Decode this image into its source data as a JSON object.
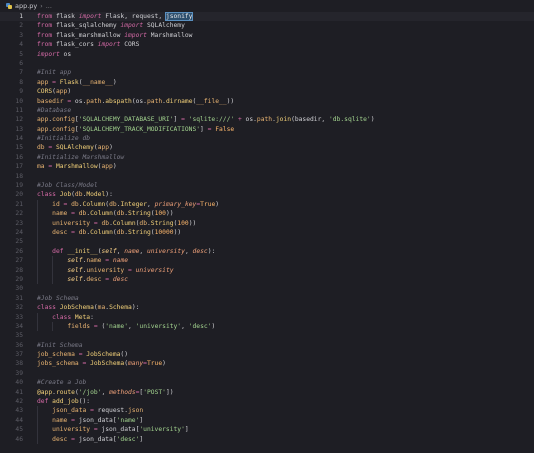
{
  "breadcrumb": {
    "file": "app.py",
    "chevron": "›",
    "ellipsis": "...",
    "icon": "python-file-icon"
  },
  "editor": {
    "active_line": 1,
    "lines": [
      {
        "n": "1",
        "indent": 0,
        "t": [
          [
            "kw2",
            "from"
          ],
          [
            "pl",
            " flask "
          ],
          [
            "kw",
            "import"
          ],
          [
            "pl",
            " Flask, request, "
          ],
          [
            "sel",
            "jsonify"
          ]
        ]
      },
      {
        "n": "2",
        "indent": 0,
        "t": [
          [
            "kw2",
            "from"
          ],
          [
            "pl",
            " flask_sqlalchemy "
          ],
          [
            "kw",
            "import"
          ],
          [
            "pl",
            " SQLAlchemy"
          ]
        ]
      },
      {
        "n": "3",
        "indent": 0,
        "t": [
          [
            "kw2",
            "from"
          ],
          [
            "pl",
            " flask_marshmallow "
          ],
          [
            "kw",
            "import"
          ],
          [
            "pl",
            " Marshmallow"
          ]
        ]
      },
      {
        "n": "4",
        "indent": 0,
        "t": [
          [
            "kw2",
            "from"
          ],
          [
            "pl",
            " flask_cors "
          ],
          [
            "kw",
            "import"
          ],
          [
            "pl",
            " CORS"
          ]
        ]
      },
      {
        "n": "5",
        "indent": 0,
        "t": [
          [
            "kw",
            "import"
          ],
          [
            "pl",
            " os"
          ]
        ]
      },
      {
        "n": "6",
        "indent": 0,
        "t": []
      },
      {
        "n": "7",
        "indent": 0,
        "t": [
          [
            "cm",
            "#Init app"
          ]
        ]
      },
      {
        "n": "8",
        "indent": 0,
        "t": [
          [
            "var",
            "app"
          ],
          [
            "op",
            " = "
          ],
          [
            "fn",
            "Flask"
          ],
          [
            "pl",
            "("
          ],
          [
            "bi",
            "__name__"
          ],
          [
            "pl",
            ")"
          ]
        ]
      },
      {
        "n": "9",
        "indent": 0,
        "t": [
          [
            "fn",
            "CORS"
          ],
          [
            "pl",
            "("
          ],
          [
            "var",
            "app"
          ],
          [
            "pl",
            ")"
          ]
        ]
      },
      {
        "n": "10",
        "indent": 0,
        "t": [
          [
            "var",
            "basedir"
          ],
          [
            "op",
            " = "
          ],
          [
            "pl",
            "os."
          ],
          [
            "var",
            "path"
          ],
          [
            "pl",
            "."
          ],
          [
            "fn",
            "abspath"
          ],
          [
            "pl",
            "(os."
          ],
          [
            "var",
            "path"
          ],
          [
            "pl",
            "."
          ],
          [
            "fn",
            "dirname"
          ],
          [
            "pl",
            "("
          ],
          [
            "bi",
            "__file__"
          ],
          [
            "pl",
            "))"
          ]
        ]
      },
      {
        "n": "11",
        "indent": 0,
        "t": [
          [
            "cm",
            "#Database"
          ]
        ]
      },
      {
        "n": "12",
        "indent": 0,
        "t": [
          [
            "var",
            "app"
          ],
          [
            "pl",
            "."
          ],
          [
            "var",
            "config"
          ],
          [
            "pl",
            "["
          ],
          [
            "str",
            "'SQLALCHEMY_DATABASE_URI'"
          ],
          [
            "pl",
            "]"
          ],
          [
            "op",
            " = "
          ],
          [
            "str",
            "'sqlite:///'"
          ],
          [
            "op",
            " + "
          ],
          [
            "pl",
            "os."
          ],
          [
            "var",
            "path"
          ],
          [
            "pl",
            "."
          ],
          [
            "fn",
            "join"
          ],
          [
            "pl",
            "(basedir, "
          ],
          [
            "str",
            "'db.sqlite'"
          ],
          [
            "pl",
            ")"
          ]
        ]
      },
      {
        "n": "13",
        "indent": 0,
        "t": [
          [
            "var",
            "app"
          ],
          [
            "pl",
            "."
          ],
          [
            "var",
            "config"
          ],
          [
            "pl",
            "["
          ],
          [
            "str",
            "'SQLALCHEMY_TRACK_MODIFICATIONS'"
          ],
          [
            "pl",
            "]"
          ],
          [
            "op",
            " = "
          ],
          [
            "num",
            "False"
          ]
        ]
      },
      {
        "n": "14",
        "indent": 0,
        "t": [
          [
            "cm",
            "#Initialize db"
          ]
        ]
      },
      {
        "n": "15",
        "indent": 0,
        "t": [
          [
            "var",
            "db"
          ],
          [
            "op",
            " = "
          ],
          [
            "fn",
            "SQLAlchemy"
          ],
          [
            "pl",
            "("
          ],
          [
            "var",
            "app"
          ],
          [
            "pl",
            ")"
          ]
        ]
      },
      {
        "n": "16",
        "indent": 0,
        "t": [
          [
            "cm",
            "#Initialize Marshmallow"
          ]
        ]
      },
      {
        "n": "17",
        "indent": 0,
        "t": [
          [
            "var",
            "ma"
          ],
          [
            "op",
            " = "
          ],
          [
            "fn",
            "Marshmallow"
          ],
          [
            "pl",
            "("
          ],
          [
            "var",
            "app"
          ],
          [
            "pl",
            ")"
          ]
        ]
      },
      {
        "n": "18",
        "indent": 0,
        "t": []
      },
      {
        "n": "19",
        "indent": 0,
        "t": [
          [
            "cm",
            "#Job Class/Model"
          ]
        ]
      },
      {
        "n": "20",
        "indent": 0,
        "t": [
          [
            "kw2",
            "class "
          ],
          [
            "cls",
            "Job"
          ],
          [
            "pl",
            "("
          ],
          [
            "var",
            "db"
          ],
          [
            "pl",
            "."
          ],
          [
            "cls",
            "Model"
          ],
          [
            "pl",
            "):"
          ]
        ]
      },
      {
        "n": "21",
        "indent": 1,
        "t": [
          [
            "pl",
            "    "
          ],
          [
            "var",
            "id"
          ],
          [
            "op",
            " = "
          ],
          [
            "var",
            "db"
          ],
          [
            "pl",
            "."
          ],
          [
            "fn",
            "Column"
          ],
          [
            "pl",
            "("
          ],
          [
            "var",
            "db"
          ],
          [
            "pl",
            "."
          ],
          [
            "cls",
            "Integer"
          ],
          [
            "pl",
            ", "
          ],
          [
            "param",
            "primary_key"
          ],
          [
            "op",
            "="
          ],
          [
            "num",
            "True"
          ],
          [
            "pl",
            ")"
          ]
        ]
      },
      {
        "n": "22",
        "indent": 1,
        "t": [
          [
            "pl",
            "    "
          ],
          [
            "var",
            "name"
          ],
          [
            "op",
            " = "
          ],
          [
            "var",
            "db"
          ],
          [
            "pl",
            "."
          ],
          [
            "fn",
            "Column"
          ],
          [
            "pl",
            "("
          ],
          [
            "var",
            "db"
          ],
          [
            "pl",
            "."
          ],
          [
            "fn",
            "String"
          ],
          [
            "pl",
            "("
          ],
          [
            "num",
            "100"
          ],
          [
            "pl",
            "))"
          ]
        ]
      },
      {
        "n": "23",
        "indent": 1,
        "t": [
          [
            "pl",
            "    "
          ],
          [
            "var",
            "university"
          ],
          [
            "op",
            " = "
          ],
          [
            "var",
            "db"
          ],
          [
            "pl",
            "."
          ],
          [
            "fn",
            "Column"
          ],
          [
            "pl",
            "("
          ],
          [
            "var",
            "db"
          ],
          [
            "pl",
            "."
          ],
          [
            "fn",
            "String"
          ],
          [
            "pl",
            "("
          ],
          [
            "num",
            "100"
          ],
          [
            "pl",
            "))"
          ]
        ]
      },
      {
        "n": "24",
        "indent": 1,
        "t": [
          [
            "pl",
            "    "
          ],
          [
            "var",
            "desc"
          ],
          [
            "op",
            " = "
          ],
          [
            "var",
            "db"
          ],
          [
            "pl",
            "."
          ],
          [
            "fn",
            "Column"
          ],
          [
            "pl",
            "("
          ],
          [
            "var",
            "db"
          ],
          [
            "pl",
            "."
          ],
          [
            "fn",
            "String"
          ],
          [
            "pl",
            "("
          ],
          [
            "num",
            "10000"
          ],
          [
            "pl",
            "))"
          ]
        ]
      },
      {
        "n": "25",
        "indent": 1,
        "t": []
      },
      {
        "n": "26",
        "indent": 1,
        "t": [
          [
            "pl",
            "    "
          ],
          [
            "kw2",
            "def "
          ],
          [
            "fn",
            "__init__"
          ],
          [
            "pl",
            "("
          ],
          [
            "self",
            "self"
          ],
          [
            "pl",
            ", "
          ],
          [
            "param",
            "name"
          ],
          [
            "pl",
            ", "
          ],
          [
            "param",
            "university"
          ],
          [
            "pl",
            ", "
          ],
          [
            "param",
            "desc"
          ],
          [
            "pl",
            "):"
          ]
        ]
      },
      {
        "n": "27",
        "indent": 2,
        "t": [
          [
            "pl",
            "        "
          ],
          [
            "self",
            "self"
          ],
          [
            "pl",
            "."
          ],
          [
            "var",
            "name"
          ],
          [
            "op",
            " = "
          ],
          [
            "param",
            "name"
          ]
        ]
      },
      {
        "n": "28",
        "indent": 2,
        "t": [
          [
            "pl",
            "        "
          ],
          [
            "self",
            "self"
          ],
          [
            "pl",
            "."
          ],
          [
            "var",
            "university"
          ],
          [
            "op",
            " = "
          ],
          [
            "param",
            "university"
          ]
        ]
      },
      {
        "n": "29",
        "indent": 2,
        "t": [
          [
            "pl",
            "        "
          ],
          [
            "self",
            "self"
          ],
          [
            "pl",
            "."
          ],
          [
            "var",
            "desc"
          ],
          [
            "op",
            " = "
          ],
          [
            "param",
            "desc"
          ]
        ]
      },
      {
        "n": "30",
        "indent": 0,
        "t": []
      },
      {
        "n": "31",
        "indent": 0,
        "t": [
          [
            "cm",
            "#Job Schema"
          ]
        ]
      },
      {
        "n": "32",
        "indent": 0,
        "t": [
          [
            "kw2",
            "class "
          ],
          [
            "cls",
            "JobSchema"
          ],
          [
            "pl",
            "("
          ],
          [
            "var",
            "ma"
          ],
          [
            "pl",
            "."
          ],
          [
            "cls",
            "Schema"
          ],
          [
            "pl",
            "):"
          ]
        ]
      },
      {
        "n": "33",
        "indent": 1,
        "t": [
          [
            "pl",
            "    "
          ],
          [
            "kw2",
            "class "
          ],
          [
            "cls",
            "Meta"
          ],
          [
            "pl",
            ":"
          ]
        ]
      },
      {
        "n": "34",
        "indent": 2,
        "t": [
          [
            "pl",
            "        "
          ],
          [
            "var",
            "fields"
          ],
          [
            "op",
            " = "
          ],
          [
            "pl",
            "("
          ],
          [
            "str",
            "'name'"
          ],
          [
            "pl",
            ", "
          ],
          [
            "str",
            "'university'"
          ],
          [
            "pl",
            ", "
          ],
          [
            "str",
            "'desc'"
          ],
          [
            "pl",
            ")"
          ]
        ]
      },
      {
        "n": "35",
        "indent": 0,
        "t": []
      },
      {
        "n": "36",
        "indent": 0,
        "t": [
          [
            "cm",
            "#Init Schema"
          ]
        ]
      },
      {
        "n": "37",
        "indent": 0,
        "t": [
          [
            "var",
            "job_schema"
          ],
          [
            "op",
            " = "
          ],
          [
            "fn",
            "JobSchema"
          ],
          [
            "pl",
            "()"
          ]
        ]
      },
      {
        "n": "38",
        "indent": 0,
        "t": [
          [
            "var",
            "jobs_schema"
          ],
          [
            "op",
            " = "
          ],
          [
            "fn",
            "JobSchema"
          ],
          [
            "pl",
            "("
          ],
          [
            "param",
            "many"
          ],
          [
            "op",
            "="
          ],
          [
            "num",
            "True"
          ],
          [
            "pl",
            ")"
          ]
        ]
      },
      {
        "n": "39",
        "indent": 0,
        "t": []
      },
      {
        "n": "40",
        "indent": 0,
        "t": [
          [
            "cm",
            "#Create a Job"
          ]
        ]
      },
      {
        "n": "41",
        "indent": 0,
        "t": [
          [
            "deco",
            "@app"
          ],
          [
            "pl",
            "."
          ],
          [
            "fn",
            "route"
          ],
          [
            "pl",
            "("
          ],
          [
            "str",
            "'/job'"
          ],
          [
            "pl",
            ", "
          ],
          [
            "param",
            "methods"
          ],
          [
            "op",
            "="
          ],
          [
            "pl",
            "["
          ],
          [
            "str",
            "'POST'"
          ],
          [
            "pl",
            "])"
          ]
        ]
      },
      {
        "n": "42",
        "indent": 0,
        "t": [
          [
            "kw2",
            "def "
          ],
          [
            "fn",
            "add_job"
          ],
          [
            "pl",
            "():"
          ]
        ]
      },
      {
        "n": "43",
        "indent": 1,
        "t": [
          [
            "pl",
            "    "
          ],
          [
            "var",
            "json_data"
          ],
          [
            "op",
            " = "
          ],
          [
            "pl",
            "request."
          ],
          [
            "var",
            "json"
          ]
        ]
      },
      {
        "n": "44",
        "indent": 1,
        "t": [
          [
            "pl",
            "    "
          ],
          [
            "var",
            "name"
          ],
          [
            "op",
            " = "
          ],
          [
            "pl",
            "json_data["
          ],
          [
            "str",
            "'name'"
          ],
          [
            "pl",
            "]"
          ]
        ]
      },
      {
        "n": "45",
        "indent": 1,
        "t": [
          [
            "pl",
            "    "
          ],
          [
            "var",
            "university"
          ],
          [
            "op",
            " = "
          ],
          [
            "pl",
            "json_data["
          ],
          [
            "str",
            "'university'"
          ],
          [
            "pl",
            "]"
          ]
        ]
      },
      {
        "n": "46",
        "indent": 1,
        "t": [
          [
            "pl",
            "    "
          ],
          [
            "var",
            "desc"
          ],
          [
            "op",
            " = "
          ],
          [
            "pl",
            "json_data["
          ],
          [
            "str",
            "'desc'"
          ],
          [
            "pl",
            "]"
          ]
        ]
      }
    ]
  }
}
